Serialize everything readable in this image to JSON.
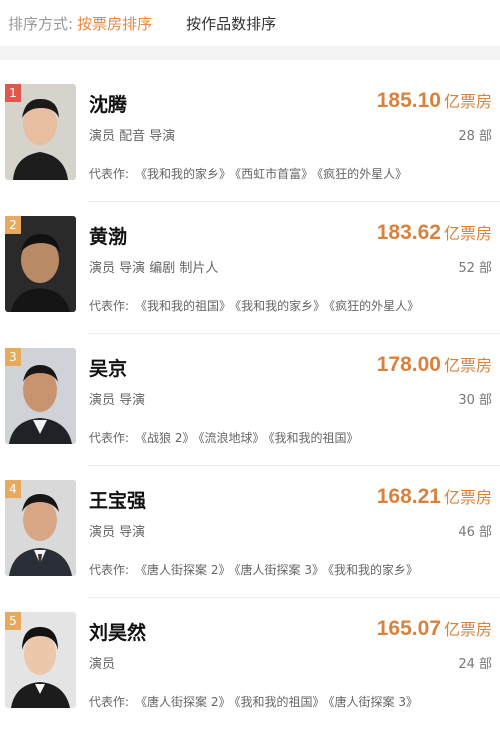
{
  "sort": {
    "label": "排序方式:",
    "active": "按票房排序",
    "other": "按作品数排序"
  },
  "colors": {
    "accent": "#e8863a",
    "box_office": "#d9823e",
    "rank_1": "#e2574c",
    "rank_other": "#e6a95e"
  },
  "works_label": "代表作:",
  "box_unit": "亿票房",
  "people": [
    {
      "rank": "1",
      "name": "沈腾",
      "box_office": "185.10",
      "roles": "演员 配音 导演",
      "count": "28 部",
      "works": [
        "《我和我的家乡》",
        "《西虹市首富》",
        "《疯狂的外星人》"
      ]
    },
    {
      "rank": "2",
      "name": "黄渤",
      "box_office": "183.62",
      "roles": "演员 导演 编剧 制片人",
      "count": "52 部",
      "works": [
        "《我和我的祖国》",
        "《我和我的家乡》",
        "《疯狂的外星人》"
      ]
    },
    {
      "rank": "3",
      "name": "吴京",
      "box_office": "178.00",
      "roles": "演员 导演",
      "count": "30 部",
      "works": [
        "《战狼 2》",
        "《流浪地球》",
        "《我和我的祖国》"
      ]
    },
    {
      "rank": "4",
      "name": "王宝强",
      "box_office": "168.21",
      "roles": "演员 导演",
      "count": "46 部",
      "works": [
        "《唐人街探案 2》",
        "《唐人街探案 3》",
        "《我和我的家乡》"
      ]
    },
    {
      "rank": "5",
      "name": "刘昊然",
      "box_office": "165.07",
      "roles": "演员",
      "count": "24 部",
      "works": [
        "《唐人街探案 2》",
        "《我和我的祖国》",
        "《唐人街探案 3》"
      ]
    }
  ]
}
